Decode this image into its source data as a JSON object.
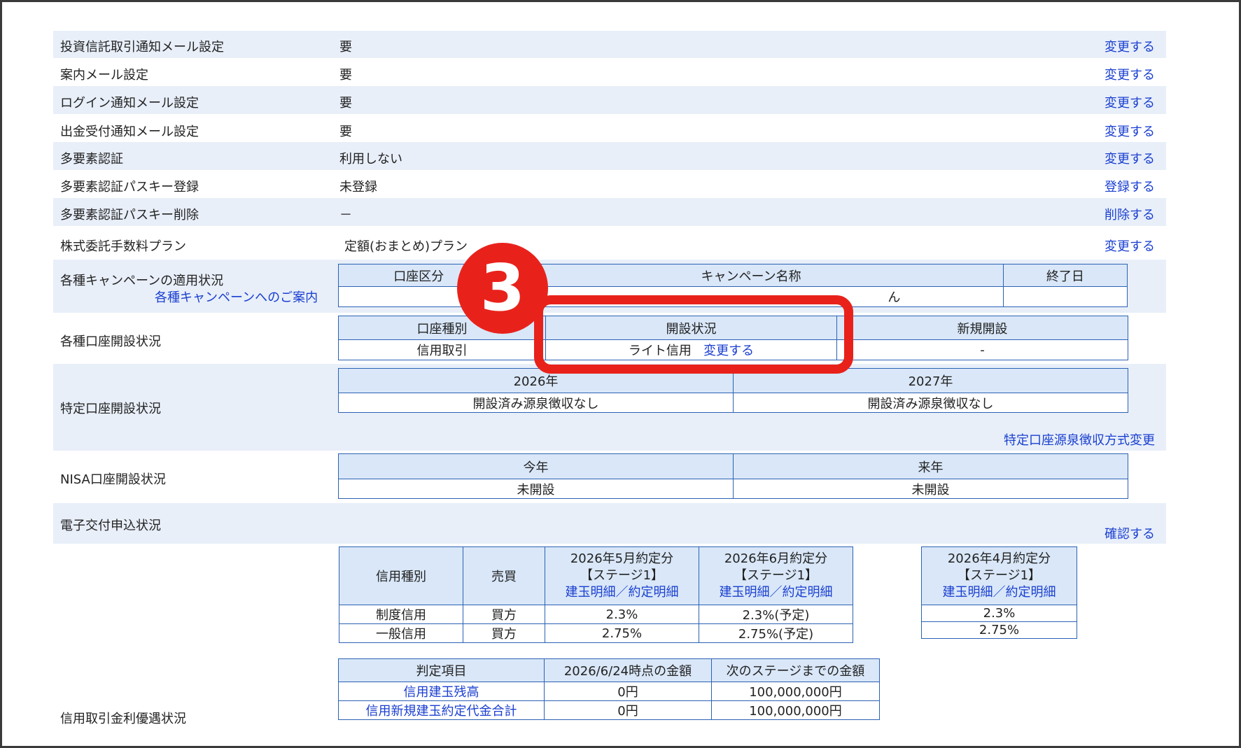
{
  "settings_rows": [
    {
      "label": "投資信託取引通知メール設定",
      "value": "要",
      "action": "変更する"
    },
    {
      "label": "案内メール設定",
      "value": "要",
      "action": "変更する"
    },
    {
      "label": "ログイン通知メール設定",
      "value": "要",
      "action": "変更する"
    },
    {
      "label": "出金受付通知メール設定",
      "value": "要",
      "action": "変更する"
    },
    {
      "label": "多要素認証",
      "value": "利用しない",
      "action": "変更する"
    },
    {
      "label": "多要素認証パスキー登録",
      "value": "未登録",
      "action": "登録する"
    },
    {
      "label": "多要素認証パスキー削除",
      "value": "－",
      "action": "削除する"
    },
    {
      "label": "株式委託手数料プラン",
      "value": "定額(おまとめ)プラン",
      "action": "変更する"
    }
  ],
  "campaign": {
    "label": "各種キャンペーンの適用状況",
    "guide_link": "各種キャンペーンへのご案内",
    "headers": [
      "口座区分",
      "キャンペーン名称",
      "終了日"
    ],
    "cell_partial": "ん"
  },
  "account_opening": {
    "label": "各種口座開設状況",
    "headers": [
      "口座種別",
      "開設状況",
      "新規開設"
    ],
    "row": {
      "type": "信用取引",
      "status": "ライト信用",
      "status_link": "変更する",
      "new": "-"
    }
  },
  "tokutei": {
    "label": "特定口座開設状況",
    "years": [
      "2026年",
      "2027年"
    ],
    "status": [
      "開設済み源泉徴収なし",
      "開設済み源泉徴収なし"
    ],
    "change_link": "特定口座源泉徴収方式変更"
  },
  "nisa": {
    "label": "NISA口座開設状況",
    "headers": [
      "今年",
      "来年"
    ],
    "values": [
      "未開設",
      "未開設"
    ]
  },
  "electronic": {
    "label": "電子交付申込状況",
    "action": "確認する"
  },
  "margin": {
    "label": "信用取引金利優遇状況",
    "rate_table": {
      "h_type": "信用種別",
      "h_side": "売買",
      "col1": {
        "month": "2026年5月約定分",
        "stage": "【ステージ1】",
        "link": "建玉明細／約定明細"
      },
      "col2": {
        "month": "2026年6月約定分",
        "stage": "【ステージ1】",
        "link": "建玉明細／約定明細"
      },
      "rows": [
        {
          "type": "制度信用",
          "side": "買方",
          "v1": "2.3%",
          "v2": "2.3%(予定)"
        },
        {
          "type": "一般信用",
          "side": "買方",
          "v1": "2.75%",
          "v2": "2.75%(予定)"
        }
      ]
    },
    "april_table": {
      "month": "2026年4月約定分",
      "stage": "【ステージ1】",
      "link": "建玉明細／約定明細",
      "values": [
        "2.3%",
        "2.75%"
      ]
    },
    "judge_table": {
      "headers": [
        "判定項目",
        "2026/6/24時点の金額",
        "次のステージまでの金額"
      ],
      "rows": [
        {
          "item": "信用建玉残高",
          "amount": "0円",
          "next": "100,000,000円"
        },
        {
          "item": "信用新規建玉約定代金合計",
          "amount": "0円",
          "next": "100,000,000円"
        }
      ]
    }
  },
  "annotation": {
    "badge": "3"
  },
  "colors": {
    "highlight": "#e8221b",
    "link": "#1a3fd0",
    "row_alt": "#e8eff9",
    "table_border": "#2c62b5",
    "header_bg": "#d9e7f8"
  }
}
